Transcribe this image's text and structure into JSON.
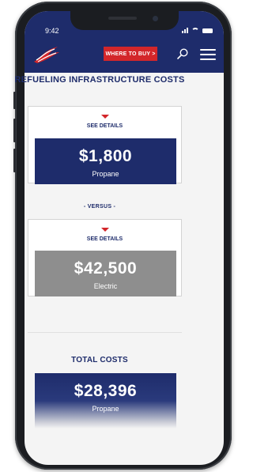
{
  "status_bar": {
    "time": "9:42"
  },
  "nav": {
    "buy_button": "WHERE TO BUY >",
    "brand_color": "#1e2c6b",
    "accent_color": "#d3262a"
  },
  "section": {
    "title": "REFUELING INFRASTRUCTURE COSTS",
    "versus": "- VERSUS -"
  },
  "cards": [
    {
      "see_details": "SEE DETAILS",
      "amount": "$1,800",
      "label": "Propane",
      "color": "#1e2c6b"
    },
    {
      "see_details": "SEE DETAILS",
      "amount": "$42,500",
      "label": "Electric",
      "color": "#8e8e8e"
    }
  ],
  "total": {
    "heading": "TOTAL COSTS",
    "amount": "$28,396",
    "label": "Propane"
  }
}
